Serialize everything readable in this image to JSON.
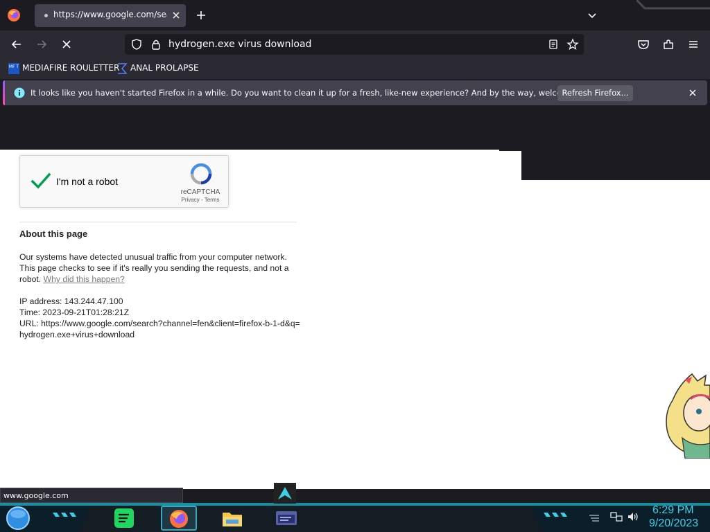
{
  "browser": {
    "tab": {
      "title": "https://www.google.com/search?channel=fen"
    },
    "url": "hydrogen.exe virus download",
    "bookmarks": [
      {
        "label": "MEDIAFIRE ROULETTER",
        "icon": "mediafire-icon",
        "icon_text": "MF T"
      },
      {
        "label": "ANAL PROLAPSE",
        "icon": "sigma-icon"
      }
    ],
    "notification": {
      "text": "It looks like you haven't started Firefox in a while. Do you want to clean it up for a fresh, like-new experience? And by the way, welcome back!",
      "button": "Refresh Firefox..."
    },
    "status_text": "www.google.com"
  },
  "page": {
    "captcha": {
      "label": "I'm not a robot",
      "brand": "reCAPTCHA",
      "privacy": "Privacy",
      "separator": " - ",
      "terms": "Terms",
      "checked": true
    },
    "about_title": "About this page",
    "about_text": "Our systems have detected unusual traffic from your computer network. This page checks to see if it's really you sending the requests, and not a robot.",
    "why_link": "Why did this happen?",
    "ip": "IP address: 143.244.47.100",
    "time": "Time: 2023-09-21T01:28:21Z",
    "url_info": "URL: https://www.google.com/search?channel=fen&client=firefox-b-1-d&q=hydrogen.exe+virus+download"
  },
  "taskbar": {
    "apps": [
      "spotify-icon",
      "firefox-icon",
      "file-explorer-icon",
      "window-icon"
    ],
    "clock_time": "6:29 PM",
    "clock_date": "9/20/2023"
  },
  "colors": {
    "toolbar": "#2b2a33",
    "tabstrip": "#1c1b22",
    "accent_clock": "#3fd0e8",
    "captcha_check": "#009e55"
  }
}
